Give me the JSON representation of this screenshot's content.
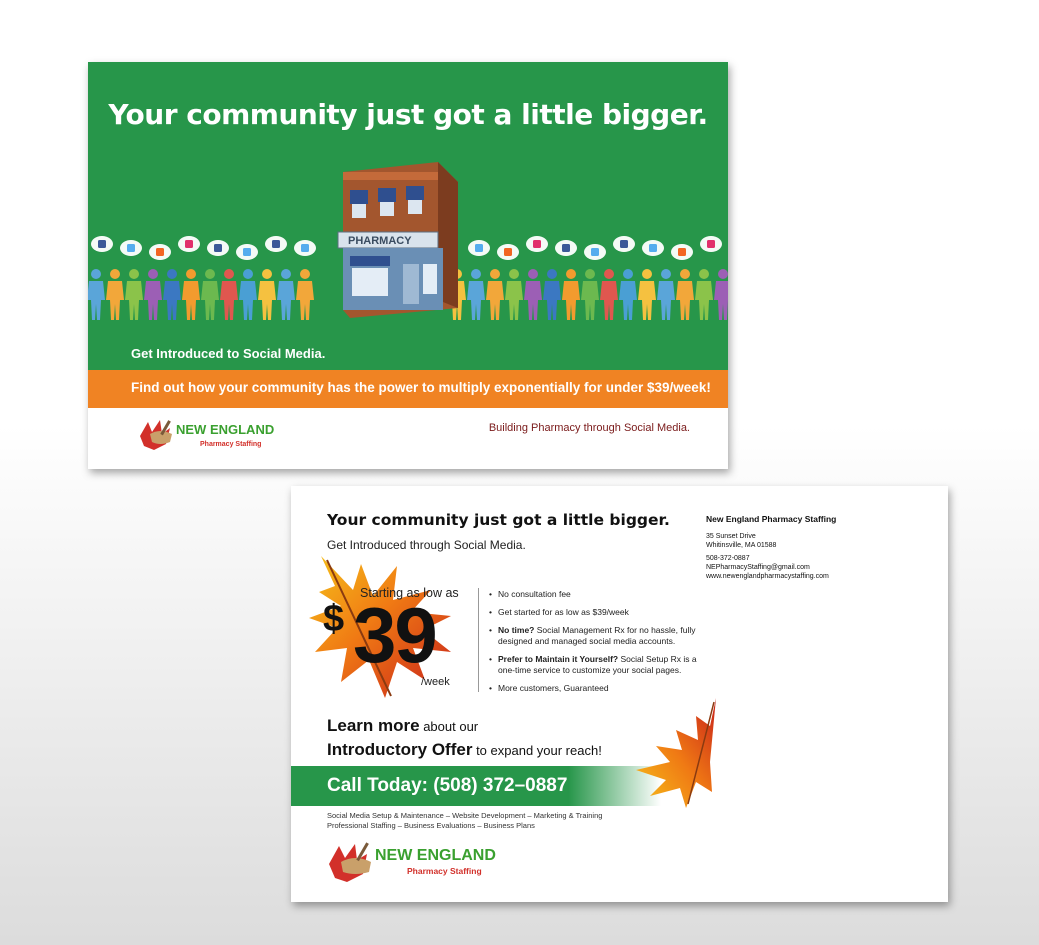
{
  "front": {
    "headline": "Your community just got a little bigger.",
    "pharmacy_sign": "PHARMACY",
    "intro": "Get Introduced to Social Media.",
    "orange_banner": "Find out how your community has the power to multiply exponentially for under $39/week!",
    "tagline": "Building Pharmacy through Social Media.",
    "logo": {
      "name": "NEW ENGLAND",
      "sub": "Pharmacy Staffing"
    }
  },
  "back": {
    "headline": "Your community just got a little bigger.",
    "subhead": "Get Introduced through Social Media.",
    "address": {
      "name": "New England Pharmacy Staffing",
      "street": "35 Sunset Drive",
      "city": "Whitinsville, MA 01588",
      "phone": "508-372-0887",
      "email": "NEPharmacyStaffing@gmail.com",
      "web": "www.newenglandpharmacystaffing.com"
    },
    "price": {
      "starting": "Starting as low as",
      "currency": "$",
      "amount": "39",
      "per": "/week"
    },
    "bullets": [
      {
        "bold": "",
        "text": "No consultation fee"
      },
      {
        "bold": "",
        "text": "Get started for as low as $39/week"
      },
      {
        "bold": "No time?",
        "text": " Social Management Rx for no hassle, fully designed and managed social media accounts."
      },
      {
        "bold": "Prefer to Maintain it Yourself?",
        "text": " Social Setup Rx is a one-time service to customize your social pages."
      },
      {
        "bold": "",
        "text": "More customers, Guaranteed"
      }
    ],
    "learn": {
      "big1": "Learn more",
      "rest1": " about our",
      "big2": "Introductory Offer",
      "rest2": " to expand your reach!"
    },
    "call": "Call Today:  (508) 372–0887",
    "services_line1": "Social Media Setup  & Maintenance – Website Development – Marketing & Training",
    "services_line2": "Professional Staffing – Business Evaluations – Business Plans",
    "logo": {
      "name": "NEW ENGLAND",
      "sub": "Pharmacy Staffing"
    }
  },
  "colors": {
    "green": "#27964a",
    "orange": "#f08323",
    "tagline": "#7a1a1a",
    "logo_green": "#3aa02f",
    "logo_red": "#d2302a"
  }
}
